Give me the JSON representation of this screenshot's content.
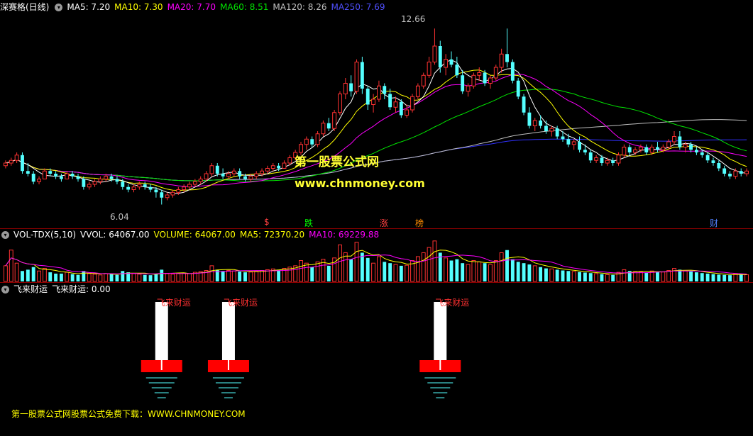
{
  "window": {
    "title": "深赛格(日线)"
  },
  "price_header": {
    "ma5": "MA5: 7.20",
    "ma10": "MA10: 7.30",
    "ma20": "MA20: 7.70",
    "ma60": "MA60: 8.51",
    "ma120": "MA120: 8.26",
    "ma250": "MA250: 7.69"
  },
  "volume_header": {
    "name": "VOL-TDX(5,10)",
    "vvol": "VVOL: 64067.00",
    "volume": "VOLUME: 64067.00",
    "ma5": "MA5: 72370.20",
    "ma10": "MA10: 69229.88"
  },
  "indicator_header": {
    "name": "飞来财运",
    "value": "飞来财运: 0.00"
  },
  "annotations": {
    "high": "12.66",
    "low": "6.04"
  },
  "event_markers": [
    "$",
    "跌",
    "涨",
    "榜",
    "财"
  ],
  "signal_label": "飞来财运",
  "watermark": {
    "line1": "第一股票公式网",
    "line2": "www.chnmoney.com"
  },
  "footer": "第一股票公式网股票公式免费下载：WWW.CHNMONEY.COM",
  "colors": {
    "up": "#ff3232",
    "down": "#54ffff",
    "ma5": "#ffffff",
    "ma10": "#ffff00",
    "ma20": "#ff00ff",
    "ma60": "#00e600",
    "ma120": "#c0c0c0",
    "ma250": "#3030ff",
    "grid": "#8b0000",
    "signal_base": "#ff0000"
  },
  "chart_data": [
    {
      "type": "candlestick",
      "title": "深赛格(日线)",
      "ylim": [
        5.6,
        13.2
      ],
      "ohlc": [
        [
          7.5,
          7.7,
          7.4,
          7.6
        ],
        [
          7.6,
          7.8,
          7.5,
          7.7
        ],
        [
          7.7,
          8.0,
          7.6,
          7.9
        ],
        [
          7.9,
          8.0,
          7.2,
          7.3
        ],
        [
          7.3,
          7.6,
          7.1,
          7.2
        ],
        [
          7.2,
          7.3,
          6.8,
          6.9
        ],
        [
          6.9,
          7.1,
          6.8,
          7.0
        ],
        [
          7.0,
          7.4,
          7.0,
          7.3
        ],
        [
          7.3,
          7.4,
          7.1,
          7.2
        ],
        [
          7.2,
          7.3,
          7.0,
          7.1
        ],
        [
          7.1,
          7.2,
          6.9,
          7.0
        ],
        [
          7.0,
          7.3,
          7.0,
          7.2
        ],
        [
          7.2,
          7.3,
          7.0,
          7.1
        ],
        [
          7.1,
          7.2,
          6.9,
          7.0
        ],
        [
          7.0,
          7.1,
          6.6,
          6.7
        ],
        [
          6.7,
          6.9,
          6.6,
          6.8
        ],
        [
          6.8,
          7.0,
          6.7,
          6.9
        ],
        [
          6.9,
          7.1,
          6.8,
          7.0
        ],
        [
          7.0,
          7.2,
          6.9,
          7.1
        ],
        [
          7.1,
          7.2,
          6.9,
          7.0
        ],
        [
          7.0,
          7.1,
          6.8,
          6.9
        ],
        [
          6.9,
          7.0,
          6.6,
          6.7
        ],
        [
          6.7,
          6.8,
          6.5,
          6.6
        ],
        [
          6.6,
          6.8,
          6.5,
          6.7
        ],
        [
          6.7,
          6.9,
          6.6,
          6.8
        ],
        [
          6.8,
          6.9,
          6.6,
          6.7
        ],
        [
          6.7,
          6.8,
          6.5,
          6.6
        ],
        [
          6.6,
          6.7,
          6.3,
          6.5
        ],
        [
          6.5,
          6.6,
          6.04,
          6.3
        ],
        [
          6.3,
          6.5,
          6.2,
          6.4
        ],
        [
          6.4,
          6.6,
          6.3,
          6.5
        ],
        [
          6.5,
          6.7,
          6.4,
          6.6
        ],
        [
          6.6,
          6.8,
          6.5,
          6.7
        ],
        [
          6.7,
          6.9,
          6.6,
          6.8
        ],
        [
          6.8,
          7.0,
          6.7,
          6.9
        ],
        [
          6.9,
          7.1,
          6.8,
          7.0
        ],
        [
          7.0,
          7.3,
          6.9,
          7.2
        ],
        [
          7.2,
          7.6,
          7.1,
          7.5
        ],
        [
          7.5,
          7.6,
          7.1,
          7.2
        ],
        [
          7.2,
          7.4,
          7.0,
          7.1
        ],
        [
          7.1,
          7.3,
          7.0,
          7.2
        ],
        [
          7.2,
          7.4,
          7.1,
          7.3
        ],
        [
          7.3,
          7.4,
          7.0,
          7.1
        ],
        [
          7.1,
          7.2,
          6.9,
          7.0
        ],
        [
          7.0,
          7.2,
          6.9,
          7.1
        ],
        [
          7.1,
          7.3,
          7.0,
          7.2
        ],
        [
          7.2,
          7.4,
          7.1,
          7.3
        ],
        [
          7.3,
          7.5,
          7.2,
          7.4
        ],
        [
          7.4,
          7.6,
          7.3,
          7.5
        ],
        [
          7.5,
          7.6,
          7.3,
          7.4
        ],
        [
          7.4,
          7.7,
          7.4,
          7.6
        ],
        [
          7.6,
          7.9,
          7.5,
          7.8
        ],
        [
          7.8,
          8.1,
          7.7,
          8.0
        ],
        [
          8.0,
          8.4,
          7.9,
          8.3
        ],
        [
          8.3,
          8.6,
          8.1,
          8.5
        ],
        [
          8.5,
          8.6,
          8.2,
          8.3
        ],
        [
          8.3,
          8.8,
          8.2,
          8.7
        ],
        [
          8.7,
          9.2,
          8.6,
          9.1
        ],
        [
          9.1,
          9.3,
          8.8,
          8.9
        ],
        [
          8.9,
          9.6,
          8.8,
          9.5
        ],
        [
          9.5,
          10.3,
          9.4,
          10.2
        ],
        [
          10.2,
          10.8,
          10.0,
          10.6
        ],
        [
          10.6,
          10.9,
          10.1,
          10.3
        ],
        [
          10.3,
          11.5,
          10.2,
          11.4
        ],
        [
          11.4,
          11.6,
          10.2,
          10.4
        ],
        [
          10.4,
          10.5,
          9.6,
          9.8
        ],
        [
          9.8,
          10.2,
          9.5,
          10.0
        ],
        [
          10.0,
          10.7,
          9.9,
          10.5
        ],
        [
          10.5,
          10.6,
          10.0,
          10.2
        ],
        [
          10.2,
          10.4,
          9.6,
          9.7
        ],
        [
          9.7,
          10.1,
          9.5,
          9.9
        ],
        [
          9.9,
          10.0,
          9.3,
          9.4
        ],
        [
          9.4,
          9.8,
          9.3,
          9.6
        ],
        [
          9.6,
          10.2,
          9.5,
          10.1
        ],
        [
          10.1,
          10.6,
          10.0,
          10.5
        ],
        [
          10.5,
          11.0,
          10.4,
          10.9
        ],
        [
          10.9,
          11.6,
          10.8,
          11.4
        ],
        [
          11.4,
          12.66,
          11.3,
          12.0
        ],
        [
          12.0,
          12.2,
          11.0,
          11.2
        ],
        [
          11.2,
          11.7,
          10.9,
          11.5
        ],
        [
          11.5,
          11.8,
          11.2,
          11.3
        ],
        [
          11.3,
          11.6,
          10.8,
          10.9
        ],
        [
          10.9,
          11.1,
          10.2,
          10.3
        ],
        [
          10.3,
          10.6,
          10.1,
          10.5
        ],
        [
          10.5,
          11.0,
          10.4,
          10.9
        ],
        [
          10.9,
          11.2,
          10.7,
          11.0
        ],
        [
          11.0,
          11.1,
          10.5,
          10.6
        ],
        [
          10.6,
          10.9,
          10.4,
          10.8
        ],
        [
          10.8,
          11.3,
          10.7,
          11.2
        ],
        [
          11.2,
          11.9,
          11.0,
          11.7
        ],
        [
          11.7,
          12.66,
          11.2,
          11.4
        ],
        [
          11.4,
          11.5,
          10.6,
          10.7
        ],
        [
          10.7,
          10.8,
          10.0,
          10.1
        ],
        [
          10.1,
          10.2,
          9.4,
          9.5
        ],
        [
          9.5,
          9.7,
          8.9,
          9.0
        ],
        [
          9.0,
          9.3,
          8.8,
          9.2
        ],
        [
          9.2,
          9.4,
          8.9,
          9.0
        ],
        [
          9.0,
          9.2,
          8.7,
          8.8
        ],
        [
          8.8,
          9.0,
          8.6,
          8.9
        ],
        [
          8.9,
          9.0,
          8.5,
          8.6
        ],
        [
          8.6,
          8.8,
          8.4,
          8.5
        ],
        [
          8.5,
          8.7,
          8.2,
          8.3
        ],
        [
          8.3,
          8.5,
          8.1,
          8.4
        ],
        [
          8.4,
          8.6,
          8.0,
          8.1
        ],
        [
          8.1,
          8.3,
          7.9,
          8.0
        ],
        [
          8.0,
          8.1,
          7.6,
          7.7
        ],
        [
          7.7,
          7.9,
          7.6,
          7.8
        ],
        [
          7.8,
          7.9,
          7.5,
          7.6
        ],
        [
          7.6,
          7.8,
          7.5,
          7.7
        ],
        [
          7.7,
          7.8,
          7.5,
          7.6
        ],
        [
          7.6,
          8.0,
          7.5,
          7.9
        ],
        [
          7.9,
          8.3,
          7.8,
          8.2
        ],
        [
          8.2,
          8.3,
          7.9,
          8.0
        ],
        [
          8.0,
          8.2,
          7.9,
          8.1
        ],
        [
          8.1,
          8.3,
          8.0,
          8.2
        ],
        [
          8.2,
          8.3,
          7.9,
          8.0
        ],
        [
          8.0,
          8.3,
          7.9,
          8.2
        ],
        [
          8.2,
          8.4,
          8.0,
          8.1
        ],
        [
          8.1,
          8.3,
          8.0,
          8.2
        ],
        [
          8.2,
          8.5,
          8.1,
          8.4
        ],
        [
          8.4,
          8.8,
          8.3,
          8.6
        ],
        [
          8.6,
          8.8,
          8.1,
          8.2
        ],
        [
          8.2,
          8.4,
          8.0,
          8.3
        ],
        [
          8.3,
          8.4,
          8.0,
          8.1
        ],
        [
          8.1,
          8.2,
          7.9,
          8.0
        ],
        [
          8.0,
          8.1,
          7.8,
          7.9
        ],
        [
          7.9,
          8.0,
          7.6,
          7.7
        ],
        [
          7.7,
          7.8,
          7.5,
          7.6
        ],
        [
          7.6,
          7.7,
          7.3,
          7.4
        ],
        [
          7.4,
          7.5,
          7.1,
          7.2
        ],
        [
          7.2,
          7.3,
          7.0,
          7.1
        ],
        [
          7.1,
          7.4,
          7.0,
          7.3
        ],
        [
          7.3,
          7.4,
          7.1,
          7.2
        ],
        [
          7.2,
          7.4,
          7.1,
          7.3
        ]
      ],
      "moving_averages": [
        "MA5",
        "MA10",
        "MA20",
        "MA60",
        "MA120",
        "MA250"
      ]
    },
    {
      "type": "bar",
      "title": "VOL-TDX(5,10)",
      "ylim": [
        0,
        160000
      ],
      "values": [
        60000,
        120000,
        70000,
        40000,
        45000,
        55000,
        40000,
        50000,
        35000,
        30000,
        30000,
        35000,
        28000,
        25000,
        40000,
        30000,
        28000,
        25000,
        30000,
        28000,
        25000,
        40000,
        35000,
        30000,
        28000,
        25000,
        24000,
        30000,
        45000,
        30000,
        28000,
        30000,
        32000,
        30000,
        35000,
        38000,
        42000,
        60000,
        45000,
        40000,
        42000,
        40000,
        38000,
        35000,
        36000,
        40000,
        42000,
        45000,
        48000,
        45000,
        50000,
        55000,
        60000,
        80000,
        70000,
        55000,
        75000,
        85000,
        60000,
        90000,
        140000,
        110000,
        85000,
        150000,
        110000,
        90000,
        70000,
        95000,
        75000,
        70000,
        65000,
        60000,
        62000,
        80000,
        95000,
        110000,
        130000,
        155000,
        110000,
        90000,
        80000,
        85000,
        70000,
        65000,
        80000,
        75000,
        70000,
        65000,
        80000,
        110000,
        120000,
        85000,
        75000,
        70000,
        65000,
        60000,
        55000,
        50000,
        48000,
        45000,
        42000,
        40000,
        38000,
        36000,
        34000,
        32000,
        30000,
        28000,
        26000,
        25000,
        35000,
        45000,
        40000,
        38000,
        36000,
        34000,
        40000,
        38000,
        36000,
        42000,
        50000,
        45000,
        40000,
        38000,
        35000,
        32000,
        30000,
        28000,
        26000,
        25000,
        24000,
        30000,
        28000,
        26000
      ],
      "series": [
        "VVOL",
        "MA5",
        "MA10"
      ]
    },
    {
      "type": "signal",
      "title": "飞来财运",
      "signals": [
        {
          "index": 28,
          "label": "飞来财运"
        },
        {
          "index": 40,
          "label": "飞来财运"
        },
        {
          "index": 78,
          "label": "飞来财运"
        }
      ],
      "value": 0.0
    }
  ]
}
